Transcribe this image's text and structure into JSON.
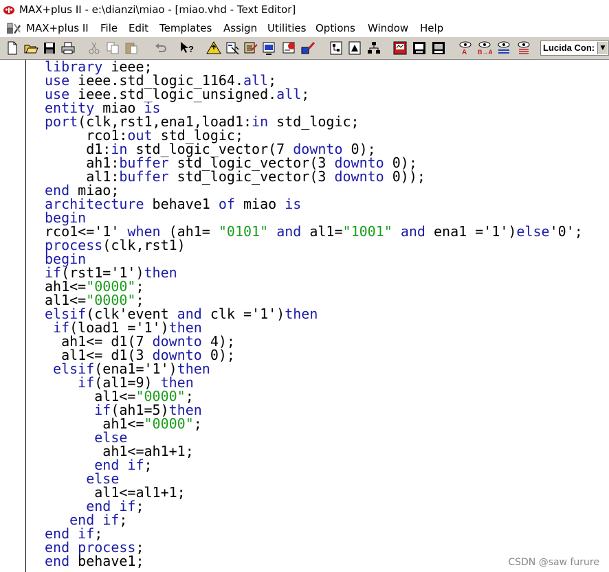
{
  "window": {
    "title": "MAX+plus II - e:\\dianzi\\miao - [miao.vhd - Text Editor]"
  },
  "menu": [
    {
      "label": "MAX+plus II"
    },
    {
      "label": "File"
    },
    {
      "label": "Edit"
    },
    {
      "label": "Templates"
    },
    {
      "label": "Assign"
    },
    {
      "label": "Utilities"
    },
    {
      "label": "Options"
    },
    {
      "label": "Window"
    },
    {
      "label": "Help"
    }
  ],
  "toolbar": {
    "font_value": "Lucida Con:",
    "buttons": [
      {
        "icon": "new-file-icon"
      },
      {
        "icon": "open-file-icon"
      },
      {
        "icon": "save-icon"
      },
      {
        "icon": "print-icon"
      },
      {
        "icon": "cut-icon"
      },
      {
        "icon": "copy-icon"
      },
      {
        "icon": "paste-icon"
      },
      {
        "icon": "undo-icon"
      },
      {
        "icon": "context-help-icon"
      },
      {
        "icon": "hierarchy-up-icon"
      },
      {
        "icon": "open-project-icon"
      },
      {
        "icon": "save-check-icon"
      },
      {
        "icon": "save-compile-icon"
      },
      {
        "icon": "save-simulate-icon"
      },
      {
        "icon": "start-compile-icon"
      },
      {
        "icon": "hierarchy-display-icon"
      },
      {
        "icon": "floorplan-icon"
      },
      {
        "icon": "compiler-icon"
      },
      {
        "icon": "simulator-icon"
      },
      {
        "icon": "timing-analyzer-icon"
      },
      {
        "icon": "programmer-icon"
      },
      {
        "icon": "find-text-icon"
      },
      {
        "icon": "find-replace-icon"
      },
      {
        "icon": "find-node-icon"
      },
      {
        "icon": "find-error-icon"
      }
    ]
  },
  "colors": {
    "keyword": "#1c1ca8",
    "string": "#1a9e1a",
    "plain": "#000000"
  },
  "code_lines": [
    [
      [
        "k",
        "library"
      ],
      [
        "p",
        " ieee;"
      ]
    ],
    [
      [
        "k",
        "use"
      ],
      [
        "p",
        " ieee.std_logic_1164."
      ],
      [
        "k",
        "all"
      ],
      [
        "p",
        ";"
      ]
    ],
    [
      [
        "k",
        "use"
      ],
      [
        "p",
        " ieee.std_logic_unsigned."
      ],
      [
        "k",
        "all"
      ],
      [
        "p",
        ";"
      ]
    ],
    [
      [
        "k",
        "entity"
      ],
      [
        "p",
        " miao "
      ],
      [
        "k",
        "is"
      ]
    ],
    [
      [
        "k",
        "port"
      ],
      [
        "p",
        "(clk,rst1,ena1,load1:"
      ],
      [
        "k",
        "in"
      ],
      [
        "p",
        " std_logic;"
      ]
    ],
    [
      [
        "p",
        "     rco1:"
      ],
      [
        "k",
        "out"
      ],
      [
        "p",
        " std_logic;"
      ]
    ],
    [
      [
        "p",
        "     d1:"
      ],
      [
        "k",
        "in"
      ],
      [
        "p",
        " std_logic_vector(7 "
      ],
      [
        "k",
        "downto"
      ],
      [
        "p",
        " 0);"
      ]
    ],
    [
      [
        "p",
        "     ah1:"
      ],
      [
        "k",
        "buffer"
      ],
      [
        "p",
        " std_logic_vector(3 "
      ],
      [
        "k",
        "downto"
      ],
      [
        "p",
        " 0);"
      ]
    ],
    [
      [
        "p",
        "     al1:"
      ],
      [
        "k",
        "buffer"
      ],
      [
        "p",
        " std_logic_vector(3 "
      ],
      [
        "k",
        "downto"
      ],
      [
        "p",
        " 0));"
      ]
    ],
    [
      [
        "k",
        "end"
      ],
      [
        "p",
        " miao;"
      ]
    ],
    [
      [
        "k",
        "architecture"
      ],
      [
        "p",
        " behave1 "
      ],
      [
        "k",
        "of"
      ],
      [
        "p",
        " miao "
      ],
      [
        "k",
        "is"
      ]
    ],
    [
      [
        "k",
        "begin"
      ]
    ],
    [
      [
        "p",
        "rco1<='1' "
      ],
      [
        "k",
        "when"
      ],
      [
        "p",
        " (ah1= "
      ],
      [
        "s",
        "\"0101\""
      ],
      [
        "p",
        " "
      ],
      [
        "k",
        "and"
      ],
      [
        "p",
        " al1="
      ],
      [
        "s",
        "\"1001\""
      ],
      [
        "p",
        " "
      ],
      [
        "k",
        "and"
      ],
      [
        "p",
        " ena1 ='1')"
      ],
      [
        "k",
        "else"
      ],
      [
        "p",
        "'0';"
      ]
    ],
    [
      [
        "k",
        "process"
      ],
      [
        "p",
        "(clk,rst1)"
      ]
    ],
    [
      [
        "k",
        "begin"
      ]
    ],
    [
      [
        "k",
        "if"
      ],
      [
        "p",
        "(rst1='1')"
      ],
      [
        "k",
        "then"
      ]
    ],
    [
      [
        "p",
        "ah1<="
      ],
      [
        "s",
        "\"0000\""
      ],
      [
        "p",
        ";"
      ]
    ],
    [
      [
        "p",
        "al1<="
      ],
      [
        "s",
        "\"0000\""
      ],
      [
        "p",
        ";"
      ]
    ],
    [
      [
        "k",
        "elsif"
      ],
      [
        "p",
        "(clk'event "
      ],
      [
        "k",
        "and"
      ],
      [
        "p",
        " clk ='1')"
      ],
      [
        "k",
        "then"
      ]
    ],
    [
      [
        "p",
        " "
      ],
      [
        "k",
        "if"
      ],
      [
        "p",
        "(load1 ='1')"
      ],
      [
        "k",
        "then"
      ]
    ],
    [
      [
        "p",
        "  ah1<= d1(7 "
      ],
      [
        "k",
        "downto"
      ],
      [
        "p",
        " 4);"
      ]
    ],
    [
      [
        "p",
        "  al1<= d1(3 "
      ],
      [
        "k",
        "downto"
      ],
      [
        "p",
        " 0);"
      ]
    ],
    [
      [
        "p",
        " "
      ],
      [
        "k",
        "elsif"
      ],
      [
        "p",
        "(ena1='1')"
      ],
      [
        "k",
        "then"
      ]
    ],
    [
      [
        "p",
        "    "
      ],
      [
        "k",
        "if"
      ],
      [
        "p",
        "(al1=9) "
      ],
      [
        "k",
        "then"
      ]
    ],
    [
      [
        "p",
        "      al1<="
      ],
      [
        "s",
        "\"0000\""
      ],
      [
        "p",
        ";"
      ]
    ],
    [
      [
        "p",
        "      "
      ],
      [
        "k",
        "if"
      ],
      [
        "p",
        "(ah1=5)"
      ],
      [
        "k",
        "then"
      ]
    ],
    [
      [
        "p",
        "       ah1<="
      ],
      [
        "s",
        "\"0000\""
      ],
      [
        "p",
        ";"
      ]
    ],
    [
      [
        "p",
        "      "
      ],
      [
        "k",
        "else"
      ]
    ],
    [
      [
        "p",
        "       ah1<=ah1+1;"
      ]
    ],
    [
      [
        "p",
        "      "
      ],
      [
        "k",
        "end"
      ],
      [
        "p",
        " "
      ],
      [
        "k",
        "if"
      ],
      [
        "p",
        ";"
      ]
    ],
    [
      [
        "p",
        "     "
      ],
      [
        "k",
        "else"
      ]
    ],
    [
      [
        "p",
        "      al1<=al1+1;"
      ]
    ],
    [
      [
        "p",
        "     "
      ],
      [
        "k",
        "end"
      ],
      [
        "p",
        " "
      ],
      [
        "k",
        "if"
      ],
      [
        "p",
        ";"
      ]
    ],
    [
      [
        "p",
        "   "
      ],
      [
        "k",
        "end"
      ],
      [
        "p",
        " "
      ],
      [
        "k",
        "if"
      ],
      [
        "p",
        ";"
      ]
    ],
    [
      [
        "k",
        "end"
      ],
      [
        "p",
        " "
      ],
      [
        "k",
        "if"
      ],
      [
        "p",
        ";"
      ]
    ],
    [
      [
        "k",
        "end"
      ],
      [
        "p",
        " "
      ],
      [
        "k",
        "process"
      ],
      [
        "p",
        ";"
      ]
    ],
    [
      [
        "k",
        "end"
      ],
      [
        "p",
        " behave1;"
      ]
    ]
  ],
  "watermark": "CSDN @saw furure"
}
